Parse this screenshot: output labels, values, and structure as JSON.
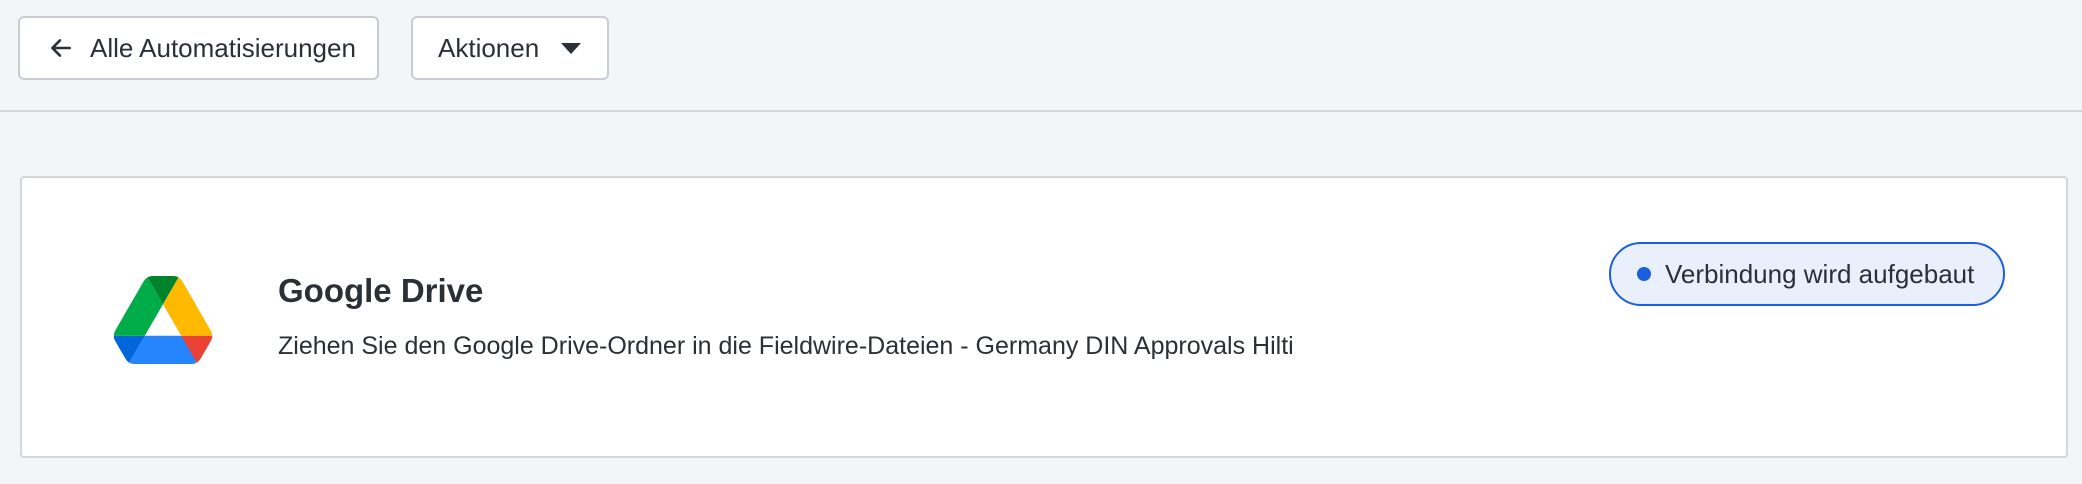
{
  "toolbar": {
    "back_label": "Alle Automatisierungen",
    "actions_label": "Aktionen"
  },
  "integration": {
    "title": "Google Drive",
    "description": "Ziehen Sie den Google Drive-Ordner in die Fieldwire-Dateien  -  Germany DIN Approvals Hilti",
    "status": "Verbindung wird aufgebaut",
    "logo_icon": "google-drive-icon"
  },
  "colors": {
    "accent": "#1a5fe0",
    "status_background": "#eaf0fb",
    "page_background": "#f4f5f7"
  }
}
